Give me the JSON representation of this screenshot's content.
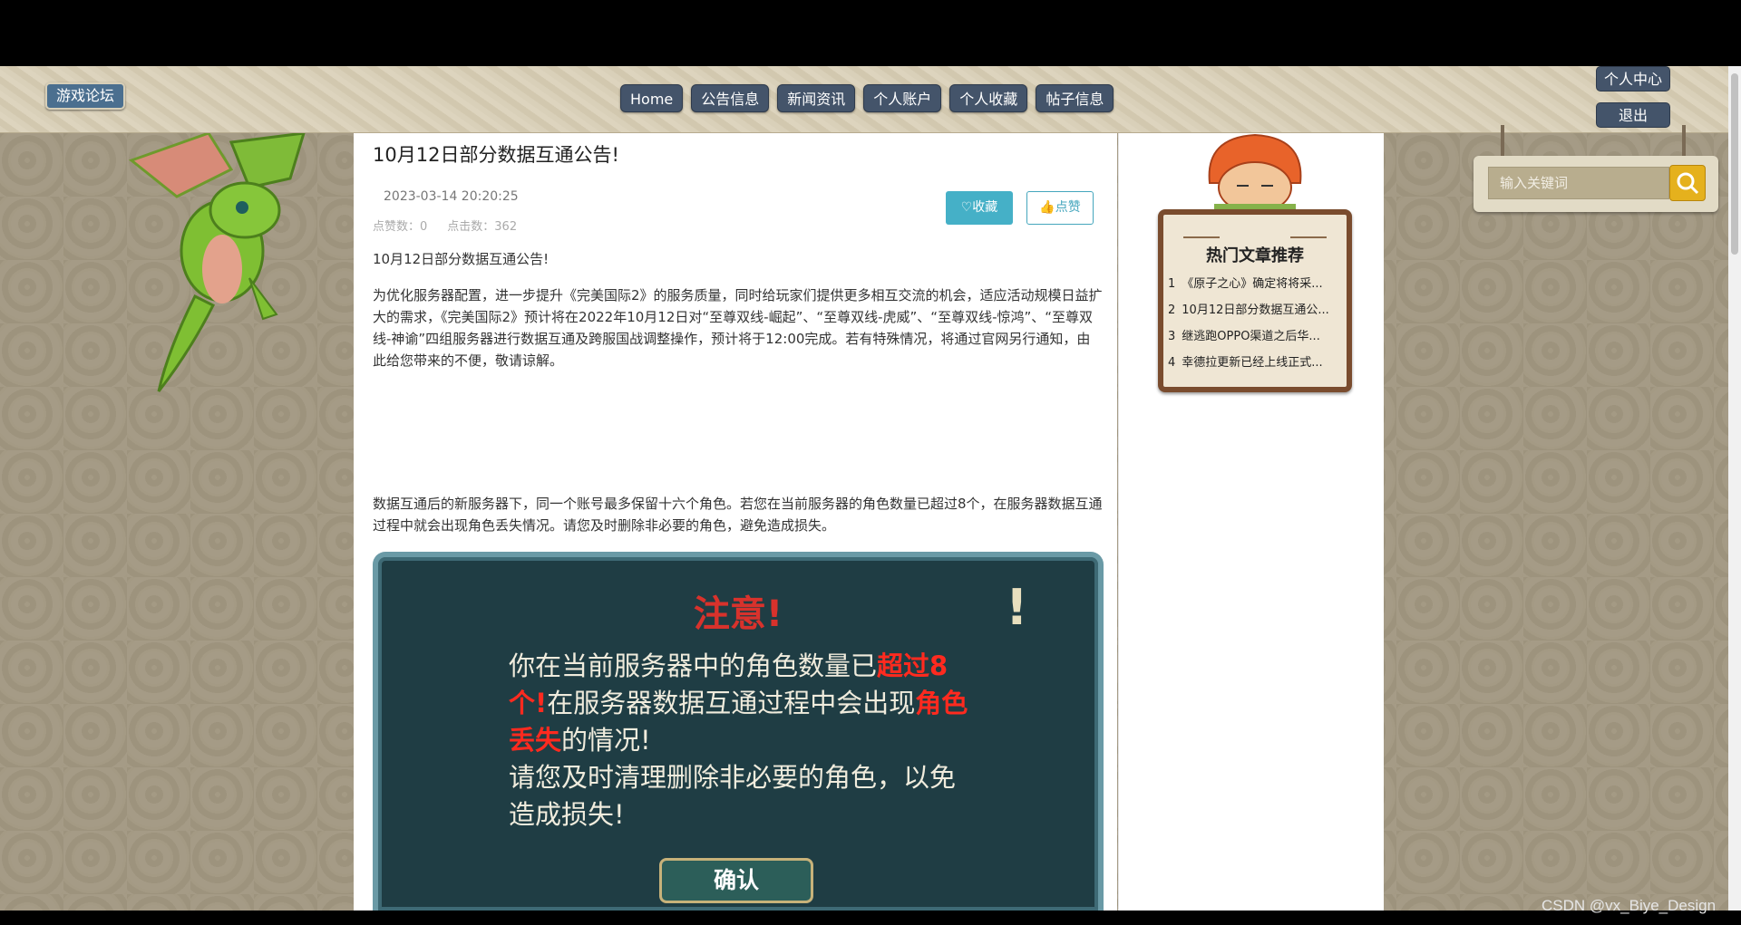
{
  "header": {
    "logo_label": "游戏论坛",
    "nav": [
      "Home",
      "公告信息",
      "新闻资讯",
      "个人账户",
      "个人收藏",
      "帖子信息"
    ],
    "user_center": "个人中心",
    "logout": "退出"
  },
  "article": {
    "title": "10月12日部分数据互通公告!",
    "date": "2023-03-14 20:20:25",
    "likes_label": "点赞数：0",
    "clicks_label": "点击数：362",
    "collect_button": "♡收藏",
    "like_button": "点赞",
    "paragraphs": [
      "10月12日部分数据互通公告!",
      "为优化服务器配置，进一步提升《完美国际2》的服务质量，同时给玩家们提供更多相互交流的机会，适应活动规模日益扩大的需求，《完美国际2》预计将在2022年10月12日对“至尊双线-崛起”、“至尊双线-虎威”、“至尊双线-惊鸿”、“至尊双线-神谕”四组服务器进行数据互通及跨服国战调整操作，预计将于12:00完成。若有特殊情况，将通过官网另行通知，由此给您带来的不便，敬请谅解。",
      "数据互通后的新服务器下，同一个账号最多保留十六个角色。若您在当前服务器的角色数量已超过8个，在服务器数据互通过程中就会出现角色丢失情况。请您及时删除非必要的角色，避免造成损失。"
    ]
  },
  "notice_image": {
    "title": "注意!",
    "exclamation": "!",
    "line1_a": "你在当前服务器中的角色数量已",
    "line1_red": "超过8个!",
    "line1_b": "在服务器数据互通过程中会出现",
    "line2_red": "角色丢失",
    "line2_b": "的情况!",
    "line3": "请您及时清理删除非必要的角色，以免造成损失!",
    "ok_button": "确认"
  },
  "hot": {
    "title": "热门文章推荐",
    "items": [
      {
        "num": "1",
        "text": "《原子之心》确定将将采..."
      },
      {
        "num": "2",
        "text": "10月12日部分数据互通公..."
      },
      {
        "num": "3",
        "text": "继逃跑OPPO渠道之后华..."
      },
      {
        "num": "4",
        "text": "幸德拉更新已经上线正式..."
      }
    ]
  },
  "search": {
    "placeholder": "输入关键词"
  },
  "watermark": "CSDN @vx_Biye_Design",
  "colors": {
    "nav_bg": "#44546a",
    "accent": "#45b0c7",
    "board_frame": "#7a4c2e"
  }
}
